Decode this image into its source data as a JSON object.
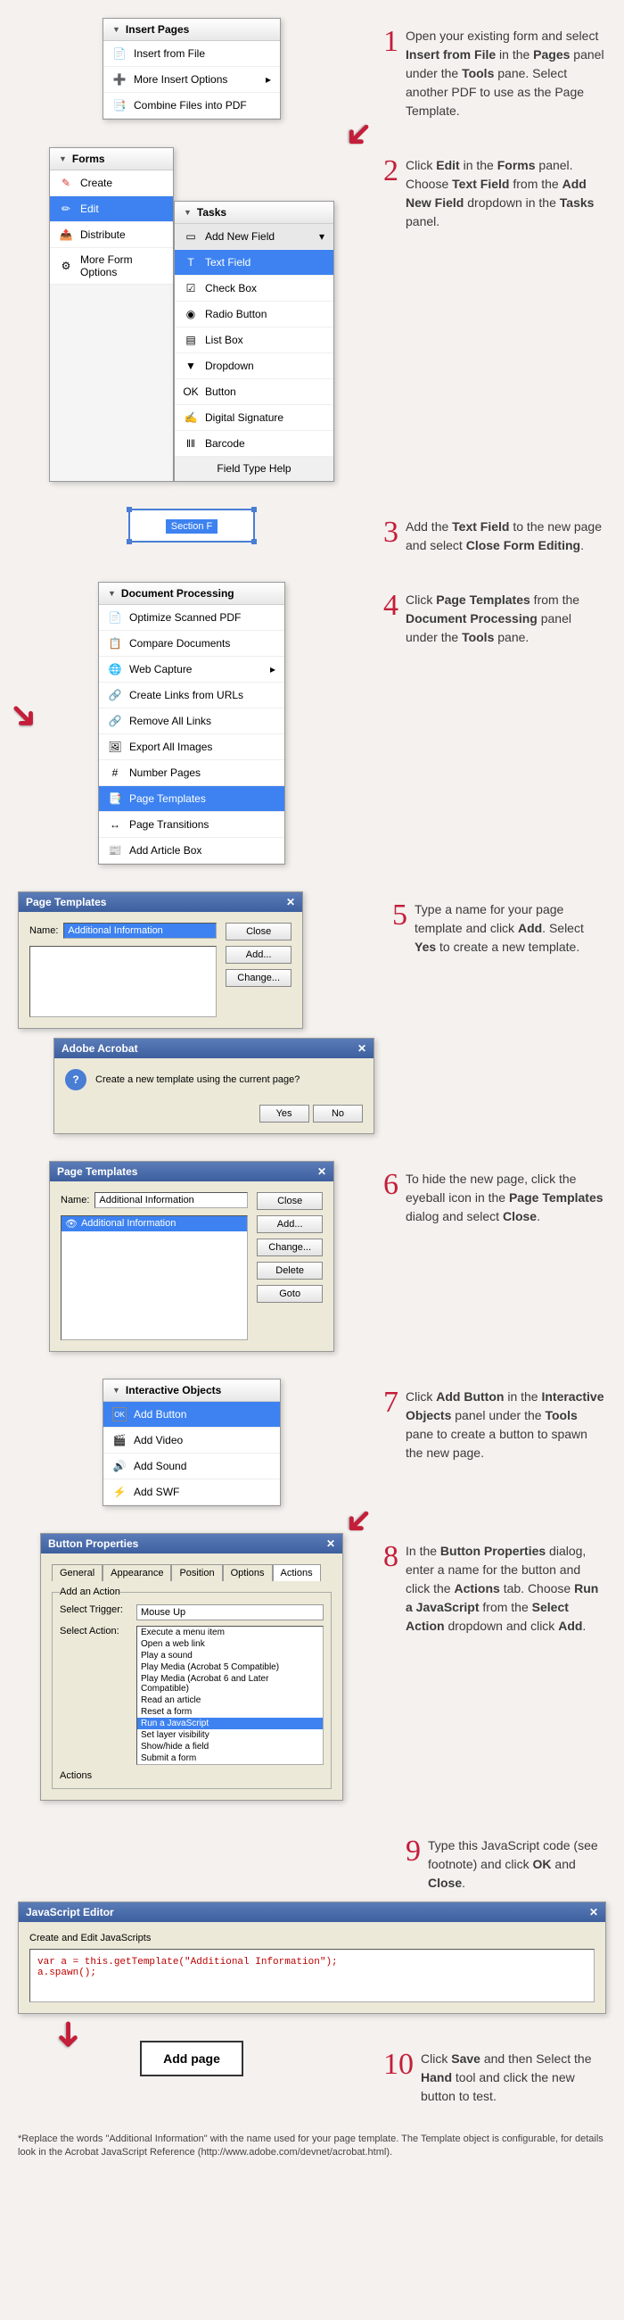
{
  "steps": [
    {
      "n": "1",
      "text": [
        "Open your existing form and select ",
        "Insert from File",
        " in the ",
        "Pages",
        " panel under the ",
        "Tools",
        " pane. Select another PDF to use as the Page Template."
      ]
    },
    {
      "n": "2",
      "text": [
        "Click ",
        "Edit",
        " in the ",
        "Forms",
        " panel. Choose ",
        "Text Field",
        " from the ",
        "Add New Field",
        " dropdown in the ",
        "Tasks",
        " panel."
      ]
    },
    {
      "n": "3",
      "text": [
        "Add the ",
        "Text Field",
        " to the new page and select ",
        "Close Form Editing",
        "."
      ]
    },
    {
      "n": "4",
      "text": [
        "Click ",
        "Page Templates",
        " from the ",
        "Document Processing",
        " panel under the ",
        "Tools",
        " pane."
      ]
    },
    {
      "n": "5",
      "text": [
        "Type a name for your page template and click ",
        "Add",
        ". Select ",
        "Yes",
        " to create a new template."
      ]
    },
    {
      "n": "6",
      "text": [
        "To hide the new page, click the eyeball icon in the ",
        "Page Templates",
        " dialog and select ",
        "Close",
        "."
      ]
    },
    {
      "n": "7",
      "text": [
        "Click ",
        "Add Button",
        " in the ",
        "Interactive Objects",
        " panel under the ",
        "Tools",
        " pane to create a button to spawn the new page."
      ]
    },
    {
      "n": "8",
      "text": [
        "In the ",
        "Button Properties",
        " dialog, enter a name for the button and click the ",
        "Actions",
        " tab. Choose ",
        "Run a JavaScript",
        " from the ",
        "Select Action",
        " dropdown and click ",
        "Add",
        "."
      ]
    },
    {
      "n": "9",
      "text": [
        "Type this JavaScript code (see footnote) and click ",
        "OK",
        " and ",
        "Close",
        "."
      ]
    },
    {
      "n": "10",
      "text": [
        "Click ",
        "Save",
        " and then Select the ",
        "Hand",
        " tool and click the new button to test."
      ]
    }
  ],
  "p1": {
    "title": "Insert Pages",
    "items": [
      "Insert from File",
      "More Insert Options",
      "Combine Files into PDF"
    ]
  },
  "p2": {
    "title": "Forms",
    "items": [
      "Create",
      "Edit",
      "Distribute",
      "More Form Options"
    ],
    "tasks_title": "Tasks",
    "add_field": "Add New Field",
    "fields": [
      "Text Field",
      "Check Box",
      "Radio Button",
      "List Box",
      "Dropdown",
      "Button",
      "Digital Signature",
      "Barcode"
    ],
    "help": "Field Type Help"
  },
  "p3": {
    "label": "Section F"
  },
  "p4": {
    "title": "Document Processing",
    "items": [
      "Optimize Scanned PDF",
      "Compare Documents",
      "Web Capture",
      "Create Links from URLs",
      "Remove All Links",
      "Export All Images",
      "Number Pages",
      "Page Templates",
      "Page Transitions",
      "Add Article Box"
    ]
  },
  "p5": {
    "title": "Page Templates",
    "name_lbl": "Name:",
    "name_val": "Additional Information",
    "buttons": [
      "Close",
      "Add...",
      "Change..."
    ],
    "confirm_title": "Adobe Acrobat",
    "confirm_msg": "Create a new template using the current page?",
    "yes": "Yes",
    "no": "No"
  },
  "p6": {
    "title": "Page Templates",
    "name_lbl": "Name:",
    "name_val": "Additional Information",
    "list_item": "Additional Information",
    "buttons": [
      "Close",
      "Add...",
      "Change...",
      "Delete",
      "Goto"
    ]
  },
  "p7": {
    "title": "Interactive Objects",
    "items": [
      "Add Button",
      "Add Video",
      "Add Sound",
      "Add SWF"
    ]
  },
  "p8": {
    "title": "Button Properties",
    "tabs": [
      "General",
      "Appearance",
      "Position",
      "Options",
      "Actions"
    ],
    "add_action": "Add an Action",
    "trigger_lbl": "Select Trigger:",
    "trigger_val": "Mouse Up",
    "action_lbl": "Select Action:",
    "actions_lbl": "Actions",
    "action_list": [
      "Execute a menu item",
      "Open a web link",
      "Play a sound",
      "Play Media (Acrobat 5 Compatible)",
      "Play Media (Acrobat 6 and Later Compatible)",
      "Read an article",
      "Reset a form",
      "Run a JavaScript",
      "Set layer visibility",
      "Show/hide a field",
      "Submit a form"
    ]
  },
  "p9": {
    "title": "JavaScript Editor",
    "label": "Create and Edit JavaScripts",
    "code": "var a = this.getTemplate(\"Additional Information\");\na.spawn();"
  },
  "p10": {
    "btn": "Add page"
  },
  "footnote": "*Replace the words \"Additional Information\" with the name used for your page template. The Template object is configurable, for details look in the Acrobat JavaScript Reference (http://www.adobe.com/devnet/acrobat.html)."
}
